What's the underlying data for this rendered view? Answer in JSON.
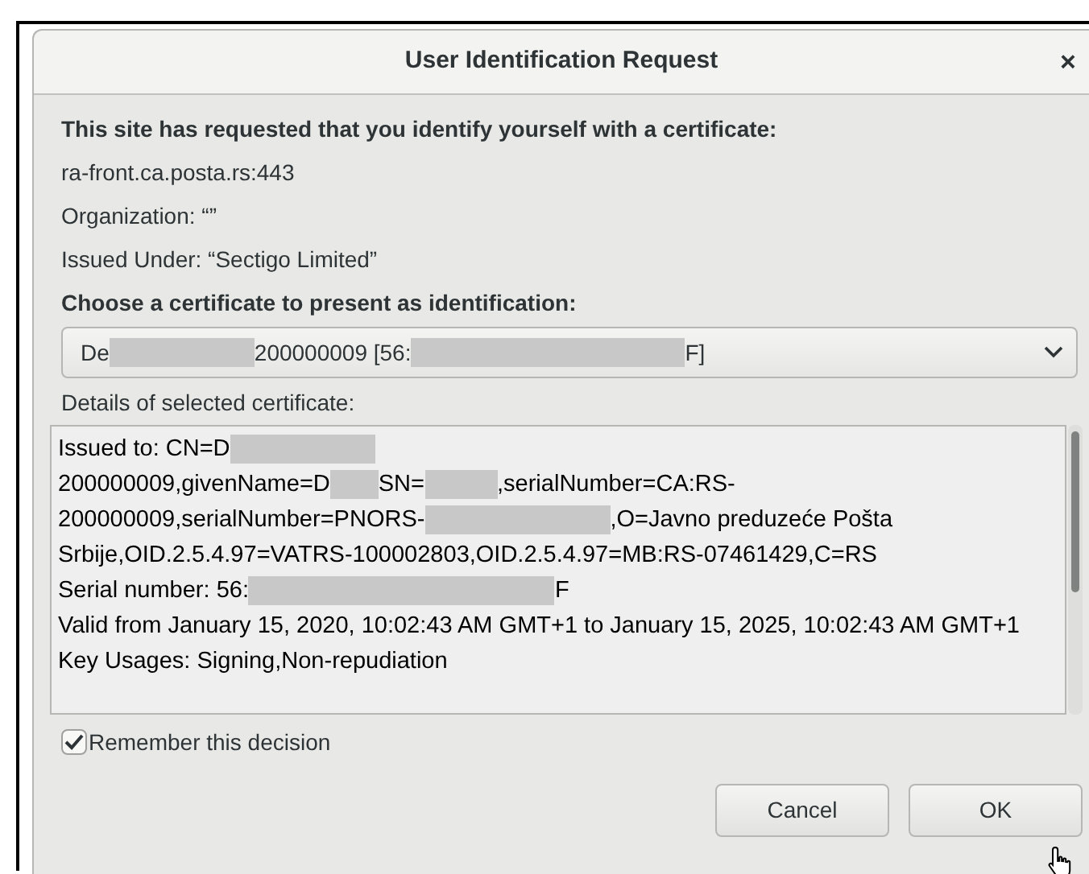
{
  "window": {
    "title": "User Identification Request",
    "close": "×"
  },
  "request": {
    "heading": "This site has requested that you identify yourself with a certificate:",
    "host": "ra-front.ca.posta.rs:443",
    "organization": "Organization: “”",
    "issuer": "Issued Under: “Sectigo Limited”"
  },
  "choose_label": "Choose a certificate to present as identification:",
  "certificate_select": {
    "parts": [
      {
        "kind": "text",
        "text": "De"
      },
      {
        "kind": "redaction"
      },
      {
        "kind": "text",
        "text": "200000009 [56:"
      },
      {
        "kind": "redaction"
      },
      {
        "kind": "text",
        "text": "F]"
      }
    ]
  },
  "details_label": "Details of selected certificate:",
  "details": [
    {
      "parts": [
        {
          "kind": "text",
          "text": "Issued to: CN=D"
        },
        {
          "kind": "redaction"
        }
      ]
    },
    {
      "parts": [
        {
          "kind": "text",
          "text": "200000009,givenName=D"
        },
        {
          "kind": "redaction"
        },
        {
          "kind": "text",
          "text": "SN="
        },
        {
          "kind": "redaction"
        },
        {
          "kind": "text",
          "text": ",serialNumber=CA:RS-"
        }
      ]
    },
    {
      "parts": [
        {
          "kind": "text",
          "text": "200000009,serialNumber=PNORS-"
        },
        {
          "kind": "redaction"
        },
        {
          "kind": "text",
          "text": ",O=Javno preduzeće Pošta"
        }
      ]
    },
    {
      "parts": [
        {
          "kind": "text",
          "text": "Srbije,OID.2.5.4.97=VATRS-100002803,OID.2.5.4.97=MB:RS-07461429,C=RS"
        }
      ]
    },
    {
      "parts": [
        {
          "kind": "text",
          "text": "Serial number: 56:"
        },
        {
          "kind": "redaction"
        },
        {
          "kind": "text",
          "text": "F"
        }
      ]
    },
    {
      "parts": [
        {
          "kind": "text",
          "text": "Valid from January 15, 2020, 10:02:43 AM GMT+1 to January 15, 2025, 10:02:43 AM GMT+1"
        }
      ]
    },
    {
      "parts": [
        {
          "kind": "text",
          "text": "Key Usages: Signing,Non-repudiation"
        }
      ]
    }
  ],
  "remember": {
    "label": "Remember this decision",
    "checked": true
  },
  "buttons": [
    {
      "label": "Cancel"
    },
    {
      "label": "OK"
    }
  ]
}
